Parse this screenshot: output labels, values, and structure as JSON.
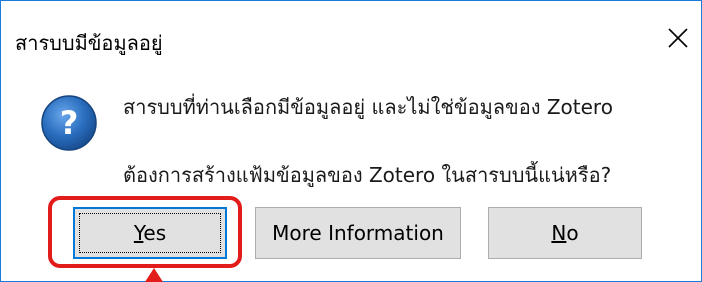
{
  "dialog": {
    "title": "สารบบมีข้อมูลอยู่",
    "close_icon": "close-icon",
    "message_icon": "question-icon",
    "message_line1": "สารบบที่ท่านเลือกมีข้อมูลอยู่ และไม่ใช่ข้อมูลของ Zotero",
    "message_line2": "ต้องการสร้างแฟ้มข้อมูลของ Zotero ในสารบบนี้แน่หรือ?",
    "buttons": {
      "yes_first": "Y",
      "yes_rest": "es",
      "more_info": "More Information",
      "no_first": "N",
      "no_rest": "o"
    }
  },
  "annotation": {
    "highlight_color": "#e21b1b",
    "pointer": "arrow-up-icon"
  },
  "colors": {
    "window_border": "#1b7bd8",
    "question_icon": "#2a6ebf",
    "button_bg": "#e1e1e1",
    "focus_border": "#0078d7"
  }
}
